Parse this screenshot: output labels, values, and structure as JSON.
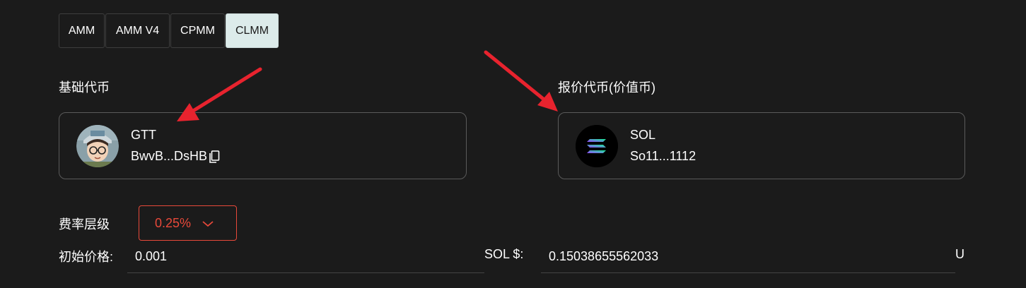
{
  "pool_tabs": [
    {
      "label": "AMM",
      "active": false
    },
    {
      "label": "AMM V4",
      "active": false
    },
    {
      "label": "CPMM",
      "active": false
    },
    {
      "label": "CLMM",
      "active": true
    }
  ],
  "base_token": {
    "label": "基础代币",
    "symbol": "GTT",
    "address": "BwvB...DsHB",
    "icon": "copy-icon"
  },
  "quote_token": {
    "label": "报价代币(价值币)",
    "symbol": "SOL",
    "address": "So11...1112"
  },
  "fee_tier": {
    "label": "费率层级",
    "value": "0.25%"
  },
  "initial_price": {
    "label": "初始价格:",
    "value": "0.001",
    "unit_label": "SOL $:",
    "usd_value": "0.15038655562033",
    "suffix": "U"
  },
  "colors": {
    "background": "#1b1b1b",
    "active_tab": "#dcebea",
    "accent_red": "#e8493a",
    "arrow_red": "#e8232e"
  }
}
